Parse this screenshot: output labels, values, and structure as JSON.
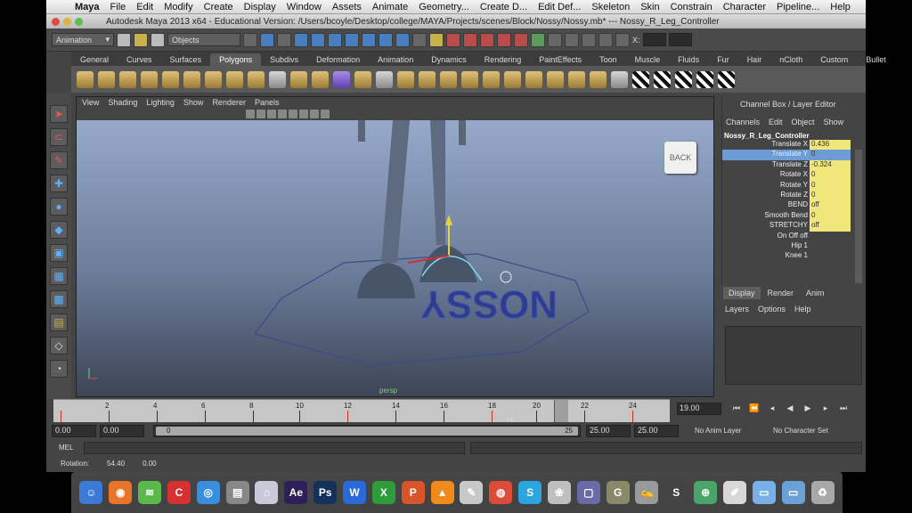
{
  "menubar": {
    "app": "Maya",
    "items": [
      "File",
      "Edit",
      "Modify",
      "Create",
      "Display",
      "Window",
      "Assets",
      "Animate",
      "Geometry...",
      "Create D...",
      "Edit Def...",
      "Skeleton",
      "Skin",
      "Constrain",
      "Character",
      "Pipeline...",
      "Help"
    ]
  },
  "window": {
    "title": "Autodesk Maya 2013 x64 - Educational Version: /Users/bcoyle/Desktop/college/MAYA/Projects/scenes/Block/Nossy/Nossy.mb*  ---  Nossy_R_Leg_Controller"
  },
  "statusline": {
    "menuset": "Animation",
    "selection_mode": "Objects",
    "x_label": "X:"
  },
  "shelf": {
    "tabs": [
      "General",
      "Curves",
      "Surfaces",
      "Polygons",
      "Subdivs",
      "Deformation",
      "Animation",
      "Dynamics",
      "Rendering",
      "PaintEffects",
      "Toon",
      "Muscle",
      "Fluids",
      "Fur",
      "Hair",
      "nCloth",
      "Custom",
      "Bullet"
    ],
    "active_tab": "Polygons"
  },
  "viewport": {
    "menus": [
      "View",
      "Shading",
      "Lighting",
      "Show",
      "Renderer",
      "Panels"
    ],
    "camera": "persp",
    "back_button": "BACK",
    "floor_text": "NOSSY"
  },
  "channel_box": {
    "title": "Channel Box / Layer Editor",
    "menus": [
      "Channels",
      "Edit",
      "Object",
      "Show"
    ],
    "node": "Nossy_R_Leg_Controller",
    "channels": [
      {
        "name": "Translate X",
        "value": "0.436",
        "highlight": true
      },
      {
        "name": "Translate Y",
        "value": "0",
        "highlight": true,
        "selected": true
      },
      {
        "name": "Translate Z",
        "value": "-0.324",
        "highlight": true
      },
      {
        "name": "Rotate X",
        "value": "0",
        "highlight": true
      },
      {
        "name": "Rotate Y",
        "value": "0",
        "highlight": true
      },
      {
        "name": "Rotate Z",
        "value": "0",
        "highlight": true
      },
      {
        "name": "BEND",
        "value": "off",
        "highlight": true
      },
      {
        "name": "Smooth Bend",
        "value": "0",
        "highlight": true
      },
      {
        "name": "STRETCHY",
        "value": "off",
        "highlight": true
      },
      {
        "name": "On Off off",
        "value": "",
        "highlight": false
      },
      {
        "name": "Hip 1",
        "value": "",
        "highlight": false
      },
      {
        "name": "Knee 1",
        "value": "",
        "highlight": false
      }
    ]
  },
  "layer_editor": {
    "tabs": [
      "Display",
      "Render",
      "Anim"
    ],
    "active_tab": "Display",
    "menus": [
      "Layers",
      "Options",
      "Help"
    ]
  },
  "timeline": {
    "labels": [
      "2",
      "4",
      "6",
      "8",
      "10",
      "12",
      "14",
      "16",
      "18",
      "20",
      "22",
      "24"
    ],
    "current_frame": "19",
    "current_time_field": "19.00"
  },
  "range": {
    "start_time": "0.00",
    "playback_start": "0.00",
    "range_min_label": "0",
    "range_max_label": "25",
    "playback_end": "25.00",
    "end_time": "25.00",
    "anim_layer": "No Anim Layer",
    "character_set": "No Character Set"
  },
  "mel": {
    "label": "MEL"
  },
  "helpline": {
    "label": "Rotation:",
    "value1": "54.40",
    "value2": "0.00"
  },
  "dock": {
    "apps": [
      {
        "name": "finder",
        "glyph": "☺",
        "color": "#3b7bd8"
      },
      {
        "name": "firefox",
        "glyph": "◉",
        "color": "#e8742a"
      },
      {
        "name": "spotify",
        "glyph": "≋",
        "color": "#5bb84a"
      },
      {
        "name": "cc",
        "glyph": "C",
        "color": "#d63030"
      },
      {
        "name": "browser",
        "glyph": "◎",
        "color": "#3a8ee0"
      },
      {
        "name": "clapper",
        "glyph": "▤",
        "color": "#888888"
      },
      {
        "name": "jar",
        "glyph": "⌂",
        "color": "#c9c9d9"
      },
      {
        "name": "aftereffects",
        "glyph": "Ae",
        "color": "#2c1f5a"
      },
      {
        "name": "photoshop",
        "glyph": "Ps",
        "color": "#16305c"
      },
      {
        "name": "word",
        "glyph": "W",
        "color": "#2a6ad8"
      },
      {
        "name": "excel",
        "glyph": "X",
        "color": "#2e9c3a"
      },
      {
        "name": "powerpoint",
        "glyph": "P",
        "color": "#d8552a"
      },
      {
        "name": "vlc",
        "glyph": "▲",
        "color": "#f08a1a"
      },
      {
        "name": "stickies",
        "glyph": "✎",
        "color": "#c8c8c8"
      },
      {
        "name": "chrome",
        "glyph": "◍",
        "color": "#dd4b39"
      },
      {
        "name": "skype",
        "glyph": "S",
        "color": "#2aa5e0"
      },
      {
        "name": "photos",
        "glyph": "❀",
        "color": "#bfbfbf"
      },
      {
        "name": "monitor",
        "glyph": "▢",
        "color": "#6a6aa8"
      },
      {
        "name": "gimp",
        "glyph": "G",
        "color": "#8a8a6a"
      },
      {
        "name": "script",
        "glyph": "✍",
        "color": "#9a9a9a"
      },
      {
        "name": "swirl",
        "glyph": "S",
        "color": "#444444"
      },
      {
        "name": "globe",
        "glyph": "⊕",
        "color": "#4aa56a"
      },
      {
        "name": "doc",
        "glyph": "✐",
        "color": "#d8d8d8"
      },
      {
        "name": "folder",
        "glyph": "▭",
        "color": "#7ab0e8"
      },
      {
        "name": "downloads",
        "glyph": "▭",
        "color": "#6aa0d8"
      },
      {
        "name": "trash",
        "glyph": "♻",
        "color": "#a8a8a8"
      }
    ]
  }
}
